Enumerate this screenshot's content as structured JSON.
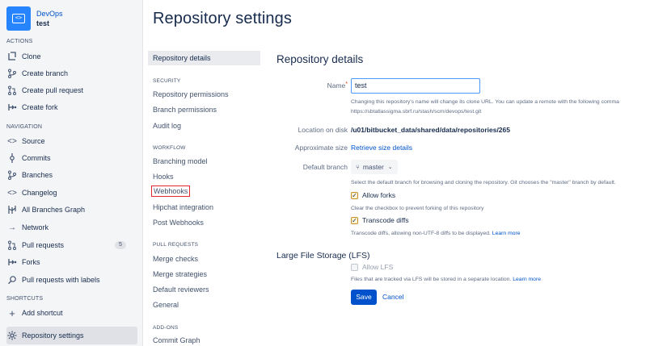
{
  "sidebar": {
    "project_name": "DevOps",
    "repo_name": "test",
    "sections": {
      "actions": "ACTIONS",
      "navigation": "NAVIGATION",
      "shortcuts": "SHORTCUTS"
    },
    "actions": [
      {
        "label": "Clone",
        "icon": "clone-icon"
      },
      {
        "label": "Create branch",
        "icon": "branch-icon"
      },
      {
        "label": "Create pull request",
        "icon": "pull-request-icon"
      },
      {
        "label": "Create fork",
        "icon": "fork-icon"
      }
    ],
    "navigation": [
      {
        "label": "Source",
        "icon": "code-icon"
      },
      {
        "label": "Commits",
        "icon": "commit-icon"
      },
      {
        "label": "Branches",
        "icon": "branch-icon"
      },
      {
        "label": "Changelog",
        "icon": "code-icon"
      },
      {
        "label": "All Branches Graph",
        "icon": "graph-icon"
      },
      {
        "label": "Network",
        "icon": "arrow-right-icon"
      },
      {
        "label": "Pull requests",
        "icon": "pull-request-icon",
        "badge": "5"
      },
      {
        "label": "Forks",
        "icon": "fork-icon"
      },
      {
        "label": "Pull requests with labels",
        "icon": "search-icon"
      }
    ],
    "shortcuts": [
      {
        "label": "Add shortcut",
        "icon": "plus-icon"
      }
    ],
    "footer_item": {
      "label": "Repository settings",
      "icon": "gear-icon"
    }
  },
  "header": {
    "title": "Repository settings"
  },
  "settings_nav": {
    "selected": "Repository details",
    "security_label": "SECURITY",
    "security": [
      "Repository permissions",
      "Branch permissions",
      "Audit log"
    ],
    "workflow_label": "WORKFLOW",
    "workflow": [
      "Branching model",
      "Hooks",
      "Webhooks",
      "Hipchat integration",
      "Post Webhooks"
    ],
    "pull_requests_label": "PULL REQUESTS",
    "pull_requests": [
      "Merge checks",
      "Merge strategies",
      "Default reviewers",
      "General"
    ],
    "addons_label": "ADD-ONS",
    "addons": [
      "Commit Graph"
    ]
  },
  "details": {
    "title": "Repository details",
    "name_label": "Name",
    "name_value": "test",
    "name_help_1": "Changing this repository's name will change its clone URL. You can update a remote with the following comma",
    "name_help_2": "https://sbtatlassigma.sbrf.ru/stash/scm/devops/test.git",
    "location_label": "Location on disk",
    "location_value": "/u01/bitbucket_data/shared/data/repositories/265",
    "size_label": "Approximate size",
    "size_link": "Retrieve size details",
    "branch_label": "Default branch",
    "branch_value": "master",
    "branch_help": "Select the default branch for browsing and cloning the repository. Git chooses the \"master\" branch by default.",
    "allow_forks_label": "Allow forks",
    "allow_forks_help": "Clear the checkbox to prevent forking of this repository",
    "transcode_label": "Transcode diffs",
    "transcode_help": "Transcode diffs, allowing non-UTF-8 diffs to be displayed.",
    "transcode_learn": "Learn more",
    "lfs_title": "Large File Storage (LFS)",
    "allow_lfs_label": "Allow LFS",
    "lfs_help": "Files that are tracked via LFS will be stored in a separate location.",
    "lfs_learn": "Learn more",
    "save_label": "Save",
    "cancel_label": "Cancel"
  }
}
